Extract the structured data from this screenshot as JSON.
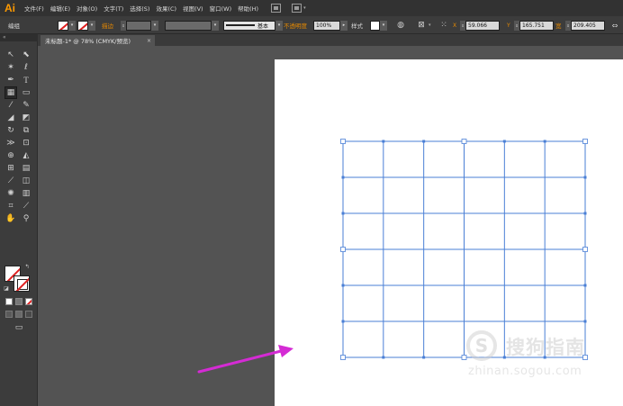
{
  "app": {
    "logo": "Ai"
  },
  "menu": [
    "文件(F)",
    "编辑(E)",
    "对象(O)",
    "文字(T)",
    "选择(S)",
    "效果(C)",
    "视图(V)",
    "窗口(W)",
    "帮助(H)"
  ],
  "control_bar": {
    "group_label": "编组",
    "stroke_label": "描边",
    "stroke_style_label": "基本",
    "opacity_label": "不透明度",
    "opacity_value": "100%",
    "style_label": "样式",
    "x_value": "59.066",
    "y_value": "165.751",
    "width_label": "宽",
    "width_value": "209.405"
  },
  "document_tab": {
    "title": "未标题-1* @ 78% (CMYK/预览)",
    "close": "×"
  },
  "toolbox": {
    "grip": "«"
  },
  "grid": {
    "columns": 6,
    "rows": 6,
    "color": "#4a7fd6"
  },
  "annotation": {
    "arrow_color": "#d42bd4"
  },
  "watermark": {
    "logo_glyph": "S",
    "text": "搜狗指南",
    "url": "zhinan.sogou.com"
  },
  "colors": {
    "menubar": "#323232",
    "panel": "#3c3c3c",
    "canvas": "#535353",
    "accent_orange": "#ff9a00"
  }
}
